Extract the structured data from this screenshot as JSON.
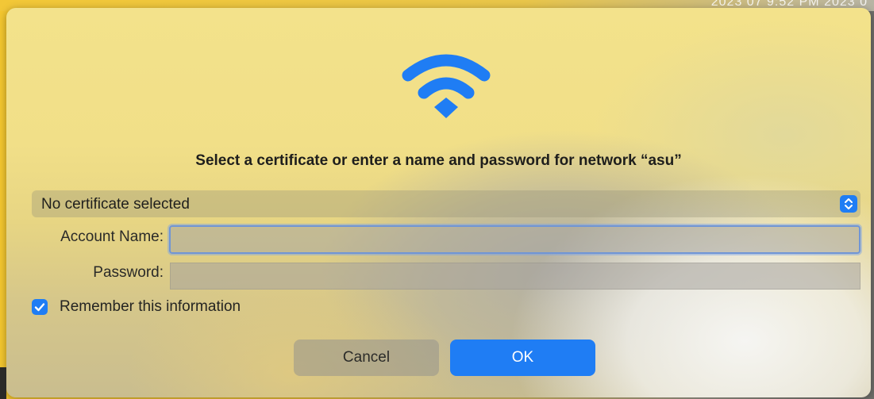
{
  "backdrop": {
    "partial_text": "2023 07 9:52 PM  2023 0"
  },
  "dialog": {
    "icon": "wifi-icon",
    "title": "Select a certificate or enter a name and password for network “asu”",
    "certificate_select": {
      "selected": "No certificate selected"
    },
    "account_name": {
      "label": "Account Name:",
      "value": "",
      "placeholder": ""
    },
    "password": {
      "label": "Password:",
      "value": "",
      "placeholder": ""
    },
    "remember": {
      "label": "Remember this information",
      "checked": true
    },
    "buttons": {
      "cancel": "Cancel",
      "ok": "OK"
    }
  },
  "colors": {
    "accent": "#1f7df4"
  }
}
